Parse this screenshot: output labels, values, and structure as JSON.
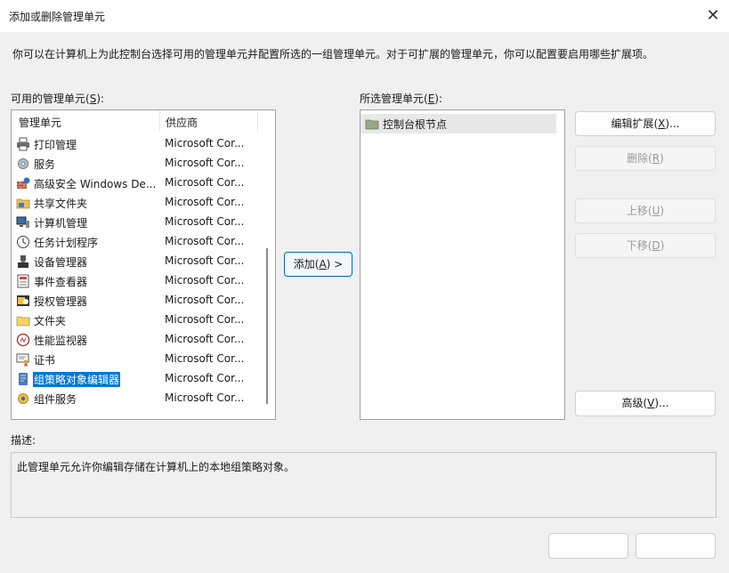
{
  "window": {
    "title": "添加或删除管理单元",
    "close_glyph": "✕"
  },
  "intro": "你可以在计算机上为此控制台选择可用的管理单元并配置所选的一组管理单元。对于可扩展的管理单元，你可以配置要启用哪些扩展项。",
  "available": {
    "label_prefix": "可用的管理单元(",
    "label_key": "S",
    "label_suffix": "):",
    "columns": [
      "管理单元",
      "供应商"
    ],
    "items": [
      {
        "name": "打印管理",
        "vendor": "Microsoft Cor...",
        "icon": "printer-icon"
      },
      {
        "name": "服务",
        "vendor": "Microsoft Cor...",
        "icon": "gear-icon"
      },
      {
        "name": "高级安全 Windows De...",
        "vendor": "Microsoft Cor...",
        "icon": "firewall-icon"
      },
      {
        "name": "共享文件夹",
        "vendor": "Microsoft Cor...",
        "icon": "shared-folder-icon"
      },
      {
        "name": "计算机管理",
        "vendor": "Microsoft Cor...",
        "icon": "computer-management-icon"
      },
      {
        "name": "任务计划程序",
        "vendor": "Microsoft Cor...",
        "icon": "clock-icon"
      },
      {
        "name": "设备管理器",
        "vendor": "Microsoft Cor...",
        "icon": "device-manager-icon"
      },
      {
        "name": "事件查看器",
        "vendor": "Microsoft Cor...",
        "icon": "event-viewer-icon"
      },
      {
        "name": "授权管理器",
        "vendor": "Microsoft Cor...",
        "icon": "authorization-icon"
      },
      {
        "name": "文件夹",
        "vendor": "Microsoft Cor...",
        "icon": "folder-icon"
      },
      {
        "name": "性能监视器",
        "vendor": "Microsoft Cor...",
        "icon": "performance-monitor-icon"
      },
      {
        "name": "证书",
        "vendor": "Microsoft Cor...",
        "icon": "certificate-icon"
      },
      {
        "name": "组策略对象编辑器",
        "vendor": "Microsoft Cor...",
        "icon": "group-policy-icon",
        "selected": true
      },
      {
        "name": "组件服务",
        "vendor": "Microsoft Cor...",
        "icon": "component-services-icon"
      }
    ]
  },
  "add_button": {
    "prefix": "添加(",
    "key": "A",
    "suffix": ") >"
  },
  "selected": {
    "label_prefix": "所选管理单元(",
    "label_key": "E",
    "label_suffix": "):",
    "items": [
      {
        "name": "控制台根节点",
        "icon": "folder-icon"
      }
    ]
  },
  "buttons": {
    "edit_ext": {
      "prefix": "编辑扩展(",
      "key": "X",
      "suffix": ")..."
    },
    "remove": {
      "prefix": "删除(",
      "key": "R",
      "suffix": ")"
    },
    "move_up": {
      "prefix": "上移(",
      "key": "U",
      "suffix": ")"
    },
    "move_down": {
      "prefix": "下移(",
      "key": "D",
      "suffix": ")"
    },
    "advanced": {
      "prefix": "高级(",
      "key": "V",
      "suffix": ")..."
    }
  },
  "description": {
    "label": "描述:",
    "text": "此管理单元允许你编辑存储在计算机上的本地组策略对象。"
  },
  "colors": {
    "selection": "#0078d7",
    "accent_border": "#0067c0"
  }
}
